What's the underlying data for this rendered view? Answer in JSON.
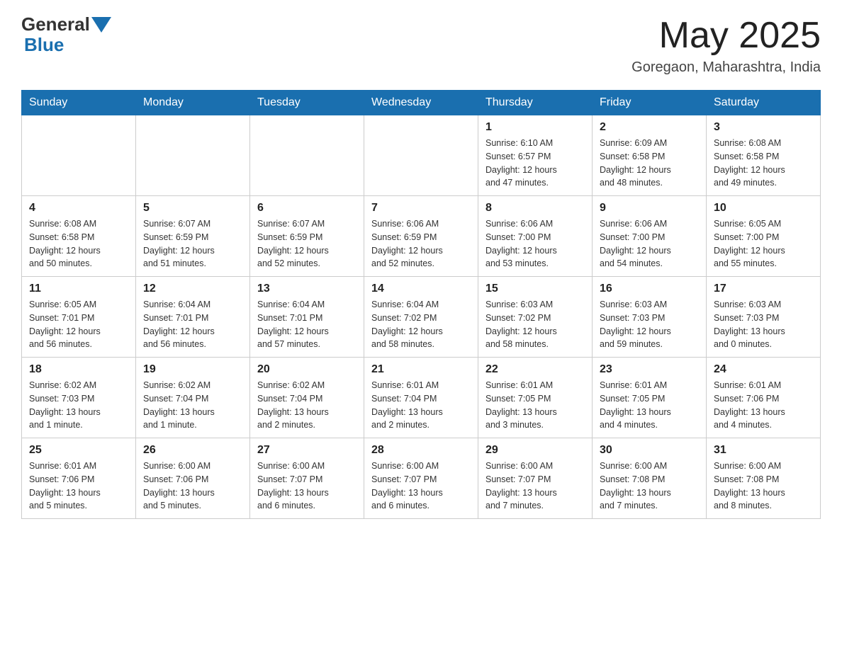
{
  "header": {
    "logo_text": "General",
    "logo_subtext": "Blue",
    "month": "May 2025",
    "location": "Goregaon, Maharashtra, India"
  },
  "days_of_week": [
    "Sunday",
    "Monday",
    "Tuesday",
    "Wednesday",
    "Thursday",
    "Friday",
    "Saturday"
  ],
  "weeks": [
    [
      {
        "day": "",
        "info": ""
      },
      {
        "day": "",
        "info": ""
      },
      {
        "day": "",
        "info": ""
      },
      {
        "day": "",
        "info": ""
      },
      {
        "day": "1",
        "info": "Sunrise: 6:10 AM\nSunset: 6:57 PM\nDaylight: 12 hours\nand 47 minutes."
      },
      {
        "day": "2",
        "info": "Sunrise: 6:09 AM\nSunset: 6:58 PM\nDaylight: 12 hours\nand 48 minutes."
      },
      {
        "day": "3",
        "info": "Sunrise: 6:08 AM\nSunset: 6:58 PM\nDaylight: 12 hours\nand 49 minutes."
      }
    ],
    [
      {
        "day": "4",
        "info": "Sunrise: 6:08 AM\nSunset: 6:58 PM\nDaylight: 12 hours\nand 50 minutes."
      },
      {
        "day": "5",
        "info": "Sunrise: 6:07 AM\nSunset: 6:59 PM\nDaylight: 12 hours\nand 51 minutes."
      },
      {
        "day": "6",
        "info": "Sunrise: 6:07 AM\nSunset: 6:59 PM\nDaylight: 12 hours\nand 52 minutes."
      },
      {
        "day": "7",
        "info": "Sunrise: 6:06 AM\nSunset: 6:59 PM\nDaylight: 12 hours\nand 52 minutes."
      },
      {
        "day": "8",
        "info": "Sunrise: 6:06 AM\nSunset: 7:00 PM\nDaylight: 12 hours\nand 53 minutes."
      },
      {
        "day": "9",
        "info": "Sunrise: 6:06 AM\nSunset: 7:00 PM\nDaylight: 12 hours\nand 54 minutes."
      },
      {
        "day": "10",
        "info": "Sunrise: 6:05 AM\nSunset: 7:00 PM\nDaylight: 12 hours\nand 55 minutes."
      }
    ],
    [
      {
        "day": "11",
        "info": "Sunrise: 6:05 AM\nSunset: 7:01 PM\nDaylight: 12 hours\nand 56 minutes."
      },
      {
        "day": "12",
        "info": "Sunrise: 6:04 AM\nSunset: 7:01 PM\nDaylight: 12 hours\nand 56 minutes."
      },
      {
        "day": "13",
        "info": "Sunrise: 6:04 AM\nSunset: 7:01 PM\nDaylight: 12 hours\nand 57 minutes."
      },
      {
        "day": "14",
        "info": "Sunrise: 6:04 AM\nSunset: 7:02 PM\nDaylight: 12 hours\nand 58 minutes."
      },
      {
        "day": "15",
        "info": "Sunrise: 6:03 AM\nSunset: 7:02 PM\nDaylight: 12 hours\nand 58 minutes."
      },
      {
        "day": "16",
        "info": "Sunrise: 6:03 AM\nSunset: 7:03 PM\nDaylight: 12 hours\nand 59 minutes."
      },
      {
        "day": "17",
        "info": "Sunrise: 6:03 AM\nSunset: 7:03 PM\nDaylight: 13 hours\nand 0 minutes."
      }
    ],
    [
      {
        "day": "18",
        "info": "Sunrise: 6:02 AM\nSunset: 7:03 PM\nDaylight: 13 hours\nand 1 minute."
      },
      {
        "day": "19",
        "info": "Sunrise: 6:02 AM\nSunset: 7:04 PM\nDaylight: 13 hours\nand 1 minute."
      },
      {
        "day": "20",
        "info": "Sunrise: 6:02 AM\nSunset: 7:04 PM\nDaylight: 13 hours\nand 2 minutes."
      },
      {
        "day": "21",
        "info": "Sunrise: 6:01 AM\nSunset: 7:04 PM\nDaylight: 13 hours\nand 2 minutes."
      },
      {
        "day": "22",
        "info": "Sunrise: 6:01 AM\nSunset: 7:05 PM\nDaylight: 13 hours\nand 3 minutes."
      },
      {
        "day": "23",
        "info": "Sunrise: 6:01 AM\nSunset: 7:05 PM\nDaylight: 13 hours\nand 4 minutes."
      },
      {
        "day": "24",
        "info": "Sunrise: 6:01 AM\nSunset: 7:06 PM\nDaylight: 13 hours\nand 4 minutes."
      }
    ],
    [
      {
        "day": "25",
        "info": "Sunrise: 6:01 AM\nSunset: 7:06 PM\nDaylight: 13 hours\nand 5 minutes."
      },
      {
        "day": "26",
        "info": "Sunrise: 6:00 AM\nSunset: 7:06 PM\nDaylight: 13 hours\nand 5 minutes."
      },
      {
        "day": "27",
        "info": "Sunrise: 6:00 AM\nSunset: 7:07 PM\nDaylight: 13 hours\nand 6 minutes."
      },
      {
        "day": "28",
        "info": "Sunrise: 6:00 AM\nSunset: 7:07 PM\nDaylight: 13 hours\nand 6 minutes."
      },
      {
        "day": "29",
        "info": "Sunrise: 6:00 AM\nSunset: 7:07 PM\nDaylight: 13 hours\nand 7 minutes."
      },
      {
        "day": "30",
        "info": "Sunrise: 6:00 AM\nSunset: 7:08 PM\nDaylight: 13 hours\nand 7 minutes."
      },
      {
        "day": "31",
        "info": "Sunrise: 6:00 AM\nSunset: 7:08 PM\nDaylight: 13 hours\nand 8 minutes."
      }
    ]
  ]
}
